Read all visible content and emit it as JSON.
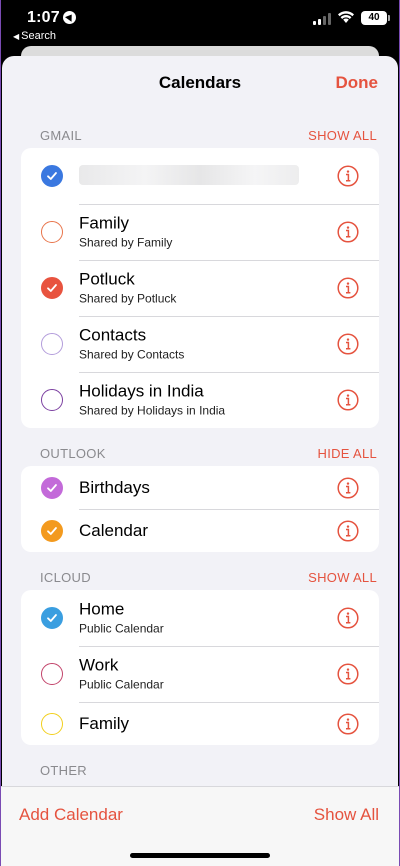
{
  "status_bar": {
    "time": "1:07",
    "back_label": "Search",
    "battery": "40"
  },
  "nav": {
    "title": "Calendars",
    "done_label": "Done"
  },
  "sections": [
    {
      "header": "GMAIL",
      "action": "SHOW ALL",
      "items": [
        {
          "title": "",
          "subtitle": "",
          "checked": true,
          "color": "#3a78e0",
          "redacted": true
        },
        {
          "title": "Family",
          "subtitle": "Shared by Family",
          "checked": false,
          "color": "#e8744a"
        },
        {
          "title": "Potluck",
          "subtitle": "Shared by Potluck",
          "checked": true,
          "color": "#e8533f"
        },
        {
          "title": "Contacts",
          "subtitle": "Shared by Contacts",
          "checked": false,
          "color": "#b39ddb"
        },
        {
          "title": "Holidays in India",
          "subtitle": "Shared by Holidays in India",
          "checked": false,
          "color": "#7b3fa0"
        }
      ]
    },
    {
      "header": "OUTLOOK",
      "action": "HIDE ALL",
      "items": [
        {
          "title": "Birthdays",
          "subtitle": "",
          "checked": true,
          "color": "#c36ad9"
        },
        {
          "title": "Calendar",
          "subtitle": "",
          "checked": true,
          "color": "#f39a1f"
        }
      ]
    },
    {
      "header": "ICLOUD",
      "action": "SHOW ALL",
      "items": [
        {
          "title": "Home",
          "subtitle": "Public Calendar",
          "checked": true,
          "color": "#3a9ee0"
        },
        {
          "title": "Work",
          "subtitle": "Public Calendar",
          "checked": false,
          "color": "#c2436a"
        },
        {
          "title": "Family",
          "subtitle": "",
          "checked": false,
          "color": "#f2cf1c"
        }
      ]
    },
    {
      "header": "OTHER",
      "action": "",
      "items": []
    }
  ],
  "bottom_bar": {
    "add_label": "Add Calendar",
    "show_all_label": "Show All"
  },
  "colors": {
    "accent": "#e5533f",
    "background": "#f2f2f7"
  }
}
